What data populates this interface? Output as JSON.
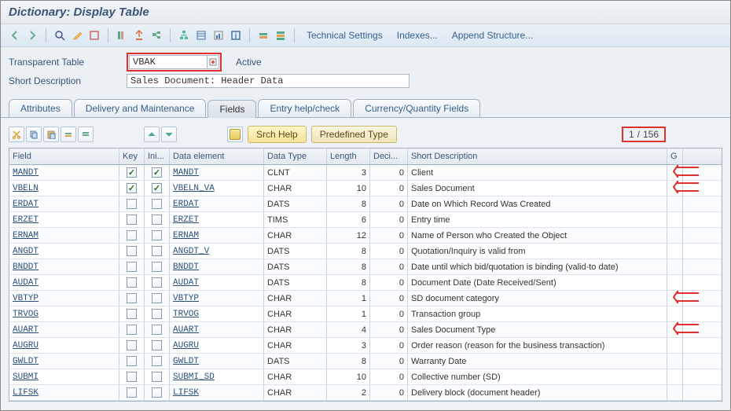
{
  "title": "Dictionary: Display Table",
  "toolbar_links": {
    "tech_settings": "Technical Settings",
    "indexes": "Indexes...",
    "append": "Append Structure..."
  },
  "form": {
    "trans_table_label": "Transparent Table",
    "trans_table_value": "VBAK",
    "status": "Active",
    "short_desc_label": "Short Description",
    "short_desc_value": "Sales Document: Header Data"
  },
  "tabs": {
    "attributes": "Attributes",
    "delivery": "Delivery and Maintenance",
    "fields": "Fields",
    "entry": "Entry help/check",
    "currency": "Currency/Quantity Fields"
  },
  "mini": {
    "srch_help": "Srch Help",
    "predefined": "Predefined Type",
    "pager_cur": "1",
    "pager_sep": "/",
    "pager_total": "156"
  },
  "headers": {
    "field": "Field",
    "key": "Key",
    "ini": "Ini...",
    "dataelem": "Data element",
    "datatype": "Data Type",
    "length": "Length",
    "decimals": "Deci...",
    "shortdesc": "Short Description",
    "gr": "G"
  },
  "rows": [
    {
      "field": "MANDT",
      "key": true,
      "ini": true,
      "elem": "MANDT",
      "type": "CLNT",
      "len": 3,
      "dec": 0,
      "desc": "Client"
    },
    {
      "field": "VBELN",
      "key": true,
      "ini": true,
      "elem": "VBELN_VA",
      "type": "CHAR",
      "len": 10,
      "dec": 0,
      "desc": "Sales Document"
    },
    {
      "field": "ERDAT",
      "key": false,
      "ini": false,
      "elem": "ERDAT",
      "type": "DATS",
      "len": 8,
      "dec": 0,
      "desc": "Date on Which Record Was Created"
    },
    {
      "field": "ERZET",
      "key": false,
      "ini": false,
      "elem": "ERZET",
      "type": "TIMS",
      "len": 6,
      "dec": 0,
      "desc": "Entry time"
    },
    {
      "field": "ERNAM",
      "key": false,
      "ini": false,
      "elem": "ERNAM",
      "type": "CHAR",
      "len": 12,
      "dec": 0,
      "desc": "Name of Person who Created the Object"
    },
    {
      "field": "ANGDT",
      "key": false,
      "ini": false,
      "elem": "ANGDT_V",
      "type": "DATS",
      "len": 8,
      "dec": 0,
      "desc": "Quotation/Inquiry is valid from"
    },
    {
      "field": "BNDDT",
      "key": false,
      "ini": false,
      "elem": "BNDDT",
      "type": "DATS",
      "len": 8,
      "dec": 0,
      "desc": "Date until which bid/quotation is binding (valid-to date)"
    },
    {
      "field": "AUDAT",
      "key": false,
      "ini": false,
      "elem": "AUDAT",
      "type": "DATS",
      "len": 8,
      "dec": 0,
      "desc": "Document Date (Date Received/Sent)"
    },
    {
      "field": "VBTYP",
      "key": false,
      "ini": false,
      "elem": "VBTYP",
      "type": "CHAR",
      "len": 1,
      "dec": 0,
      "desc": "SD document category"
    },
    {
      "field": "TRVOG",
      "key": false,
      "ini": false,
      "elem": "TRVOG",
      "type": "CHAR",
      "len": 1,
      "dec": 0,
      "desc": "Transaction group"
    },
    {
      "field": "AUART",
      "key": false,
      "ini": false,
      "elem": "AUART",
      "type": "CHAR",
      "len": 4,
      "dec": 0,
      "desc": "Sales Document Type"
    },
    {
      "field": "AUGRU",
      "key": false,
      "ini": false,
      "elem": "AUGRU",
      "type": "CHAR",
      "len": 3,
      "dec": 0,
      "desc": "Order reason (reason for the business transaction)"
    },
    {
      "field": "GWLDT",
      "key": false,
      "ini": false,
      "elem": "GWLDT",
      "type": "DATS",
      "len": 8,
      "dec": 0,
      "desc": "Warranty Date"
    },
    {
      "field": "SUBMI",
      "key": false,
      "ini": false,
      "elem": "SUBMI_SD",
      "type": "CHAR",
      "len": 10,
      "dec": 0,
      "desc": "Collective number (SD)"
    },
    {
      "field": "LIFSK",
      "key": false,
      "ini": false,
      "elem": "LIFSK",
      "type": "CHAR",
      "len": 2,
      "dec": 0,
      "desc": "Delivery block (document header)"
    }
  ],
  "arrows": [
    0,
    1,
    8,
    10
  ]
}
